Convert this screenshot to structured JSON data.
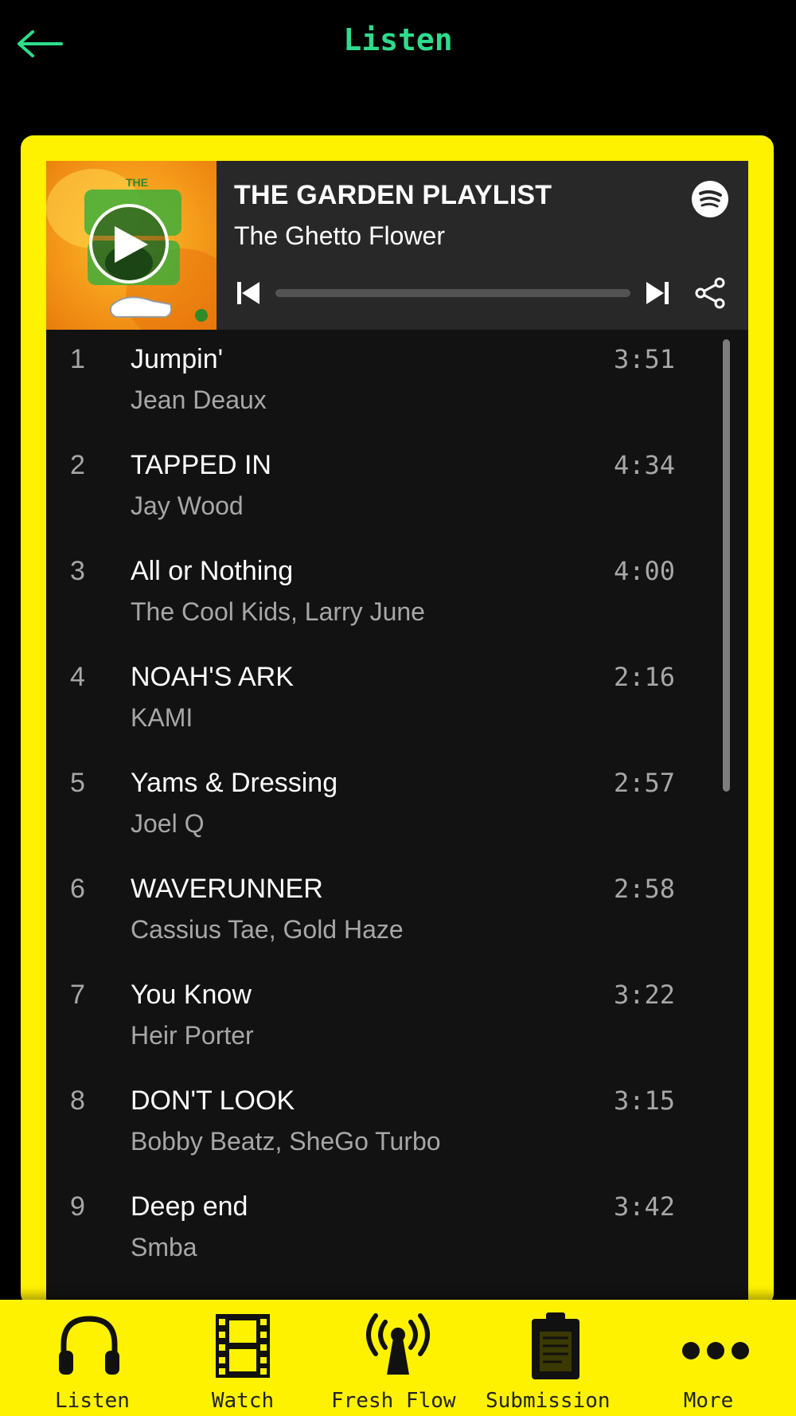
{
  "header": {
    "title": "Listen"
  },
  "player": {
    "playlist_title": "THE GARDEN PLAYLIST",
    "playlist_owner": "The Ghetto Flower",
    "cover_text": "THE GARDEN",
    "progress": 0.0,
    "accent_color": "#fff200"
  },
  "tracks": [
    {
      "num": "1",
      "title": "Jumpin'",
      "artist": "Jean Deaux",
      "duration": "3:51"
    },
    {
      "num": "2",
      "title": "TAPPED IN",
      "artist": "Jay Wood",
      "duration": "4:34"
    },
    {
      "num": "3",
      "title": "All or Nothing",
      "artist": "The Cool Kids, Larry June",
      "duration": "4:00"
    },
    {
      "num": "4",
      "title": "NOAH'S ARK",
      "artist": "KAMI",
      "duration": "2:16"
    },
    {
      "num": "5",
      "title": "Yams & Dressing",
      "artist": "Joel Q",
      "duration": "2:57"
    },
    {
      "num": "6",
      "title": "WAVERUNNER",
      "artist": "Cassius Tae, Gold Haze",
      "duration": "2:58"
    },
    {
      "num": "7",
      "title": "You Know",
      "artist": "Heir Porter",
      "duration": "3:22"
    },
    {
      "num": "8",
      "title": "DON'T LOOK",
      "artist": "Bobby Beatz, SheGo Turbo",
      "duration": "3:15"
    },
    {
      "num": "9",
      "title": "Deep end",
      "artist": "Smba",
      "duration": "3:42"
    }
  ],
  "bottom_nav": {
    "items": [
      {
        "label": "Listen",
        "icon": "headphones-icon"
      },
      {
        "label": "Watch",
        "icon": "film-icon"
      },
      {
        "label": "Fresh Flow",
        "icon": "broadcast-icon"
      },
      {
        "label": "Submission",
        "icon": "clipboard-icon"
      },
      {
        "label": "More",
        "icon": "more-dots-icon"
      }
    ]
  }
}
